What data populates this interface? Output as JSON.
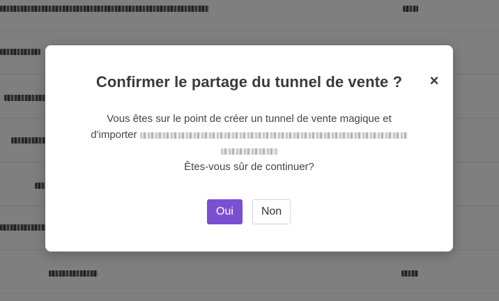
{
  "dialog": {
    "title": "Confirmer le partage du tunnel de vente ?",
    "close_symbol": "×",
    "message_line1": "Vous êtes sur le point de créer un tunnel de vente magique et",
    "message_line2_prefix": "d'importer",
    "message_question": "Êtes-vous sûr de continuer?",
    "yes_label": "Oui",
    "no_label": "Non",
    "accent_color": "#7a4fd2"
  },
  "icons": {
    "close": "close-icon"
  }
}
